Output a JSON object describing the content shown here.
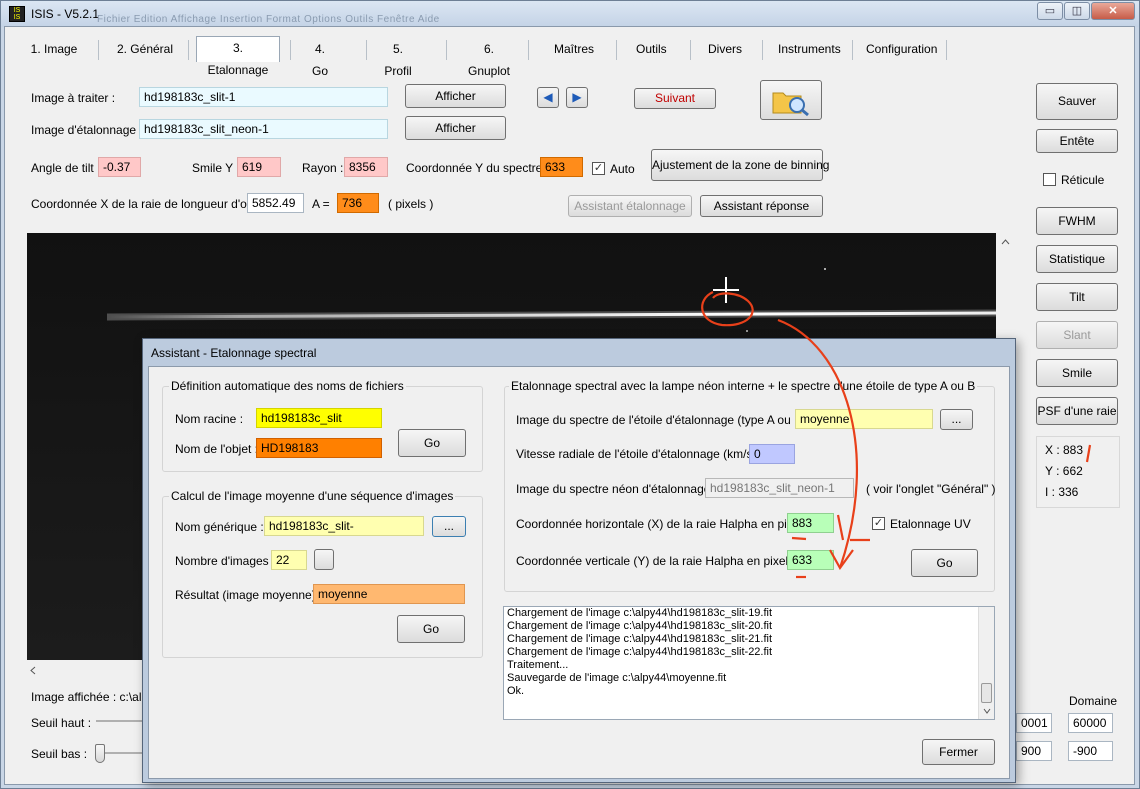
{
  "window": {
    "title": "ISIS - V5.2.1",
    "ghost_menu": "Fichier  Edition  Affichage  Insertion  Format  Options  Outils  Fenêtre  Aide",
    "min": "▭",
    "restore": "◫",
    "close": "✕"
  },
  "tabs": [
    "1. Image",
    "2. Général",
    "3. Etalonnage",
    "4. Go",
    "5. Profil",
    "6. Gnuplot",
    "Maîtres",
    "Outils",
    "Divers",
    "Instruments",
    "Configuration"
  ],
  "selected_tab": "3. Etalonnage",
  "top": {
    "image_label": "Image à traiter :",
    "image_value": "hd198183c_slit-1",
    "afficher1": "Afficher",
    "calib_label": "Image d'étalonnage :",
    "calib_value": "hd198183c_slit_neon-1",
    "afficher2": "Afficher",
    "suivant": "Suivant",
    "prev": "◀",
    "next": "▶",
    "tilt_label": "Angle de tilt :",
    "tilt_value": "-0.37",
    "smile_label": "Smile Y :",
    "smile_value": "619",
    "rayon_label": "Rayon :",
    "rayon_value": "8356",
    "coordy_label": "Coordonnée Y du spectre :",
    "coordy_value": "633",
    "auto_label": "Auto",
    "auto_checked": "✓",
    "binning_btn": "Ajustement de la zone de binning",
    "coordx_label": "Coordonnée X de la raie de longueur d'onde",
    "coordx_value": "5852.49",
    "a_label": "A  =",
    "a_value": "736",
    "pixels_label": "( pixels )",
    "assistant_etal": "Assistant étalonnage",
    "assistant_rep": "Assistant réponse"
  },
  "right": {
    "sauver": "Sauver",
    "entete": "Entête",
    "reticule": "Réticule",
    "fwhm": "FWHM",
    "statistique": "Statistique",
    "tilt": "Tilt",
    "slant": "Slant",
    "smile": "Smile",
    "psf": "PSF d'une raie",
    "x_readout": "X : 883",
    "y_readout": "Y : 662",
    "i_readout": "I : 336",
    "domaine": "Domaine",
    "domaine_high": "60000",
    "domaine_low": "-900",
    "hidden_high": "0001",
    "hidden_low": "900"
  },
  "bottom": {
    "image_affichee": "Image affichée : c:\\alpy",
    "seuil_haut": "Seuil haut :",
    "seuil_bas": "Seuil bas :"
  },
  "dialog": {
    "title": "Assistant - Etalonnage spectral",
    "g1": {
      "title": "Définition automatique des noms de fichiers",
      "racine_label": "Nom racine :",
      "racine_value": "hd198183c_slit",
      "objet_label": "Nom de l'objet :",
      "objet_value": "HD198183",
      "go": "Go"
    },
    "g2": {
      "title": "Calcul de l'image moyenne d'une séquence d'images",
      "generique_label": "Nom générique :",
      "generique_value": "hd198183c_slit-",
      "browse": "...",
      "nombre_label": "Nombre d'images :",
      "nombre_value": "22",
      "resultat_label": "Résultat (image moyenne) :",
      "resultat_value": "moyenne",
      "go": "Go"
    },
    "g3": {
      "title": "Etalonnage spectral avec la lampe néon interne + le spectre d'une étoile de type A ou B",
      "spectre_label": "Image du spectre de l'étoile d'étalonnage (type A ou B) :",
      "spectre_value": "moyenne",
      "browse": "...",
      "vitesse_label": "Vitesse radiale de l'étoile d'étalonnage (km/s) :",
      "vitesse_value": "0",
      "neon_label": "Image du spectre néon d'étalonnage :",
      "neon_value": "hd198183c_slit_neon-1",
      "neon_note": "( voir l'onglet \"Général\" )",
      "horiz_label": "Coordonnée horizontale (X) de la raie Halpha en pixels :",
      "horiz_value": "883",
      "uv_label": "Etalonnage UV",
      "uv_checked": "✓",
      "vert_label": "Coordonnée verticale (Y) de la raie Halpha en pixels :",
      "vert_value": "633",
      "go": "Go"
    },
    "log": [
      "Chargement de l'image c:\\alpy44\\hd198183c_slit-19.fit",
      "Chargement de l'image c:\\alpy44\\hd198183c_slit-20.fit",
      "Chargement de l'image c:\\alpy44\\hd198183c_slit-21.fit",
      "Chargement de l'image c:\\alpy44\\hd198183c_slit-22.fit",
      "Traitement...",
      "Sauvegarde de l'image c:\\alpy44\\moyenne.fit",
      "Ok."
    ],
    "fermer": "Fermer"
  },
  "colors": {
    "annotation": "#e8401a",
    "spectrum": "#ffffff",
    "image_bg": "#0f0f0f"
  }
}
